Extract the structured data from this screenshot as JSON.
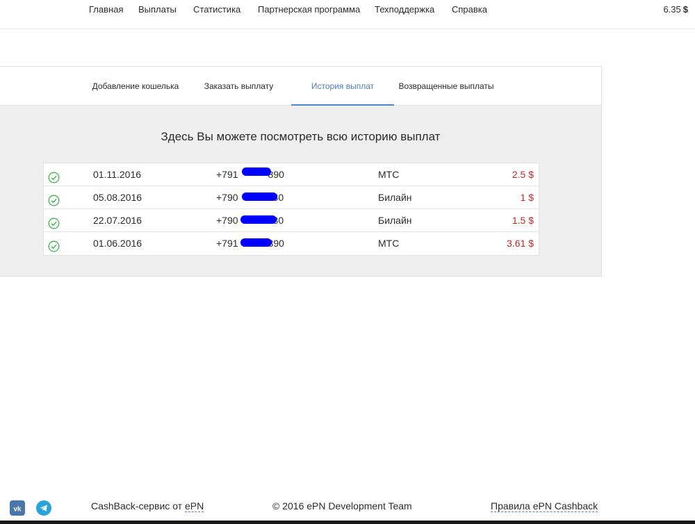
{
  "nav": {
    "items": [
      "Главная",
      "Выплаты",
      "Статистика",
      "Партнерская программа",
      "Техподдержка",
      "Справка"
    ],
    "balance_value": "6.35",
    "balance_currency": "$"
  },
  "tabs": [
    {
      "label": "Добавление кошелька",
      "active": false
    },
    {
      "label": "Заказать выплату",
      "active": false
    },
    {
      "label": "История выплат",
      "active": true
    },
    {
      "label": "Возвращенные выплаты",
      "active": false
    }
  ],
  "heading": "Здесь Вы можете посмотреть всю историю выплат",
  "payouts": [
    {
      "date": "01.11.2016",
      "phone": "+791",
      "phone_end": "890",
      "operator": "МТС",
      "amount": "2.5 $"
    },
    {
      "date": "05.08.2016",
      "phone": "+790",
      "phone_end": "80",
      "operator": "Билайн",
      "amount": "1 $"
    },
    {
      "date": "22.07.2016",
      "phone": "+790",
      "phone_end": "80",
      "operator": "Билайн",
      "amount": "1.5 $"
    },
    {
      "date": "01.06.2016",
      "phone": "+791",
      "phone_end": "890",
      "operator": "МТС",
      "amount": "3.61 $"
    }
  ],
  "footer": {
    "service_prefix": "CashBack-сервис от ",
    "service_link": "ePN",
    "copyright": "© 2016 ePN Development Team",
    "rules_link": "Правила ePN Cashback"
  },
  "icons": {
    "vk": "vk-icon",
    "telegram": "telegram-icon",
    "check": "check-circle-icon"
  },
  "colors": {
    "accent": "#4a86d4",
    "amount": "#c62828",
    "success": "#3bb54a",
    "vk": "#4a76a8",
    "telegram": "#2aa3dc"
  }
}
